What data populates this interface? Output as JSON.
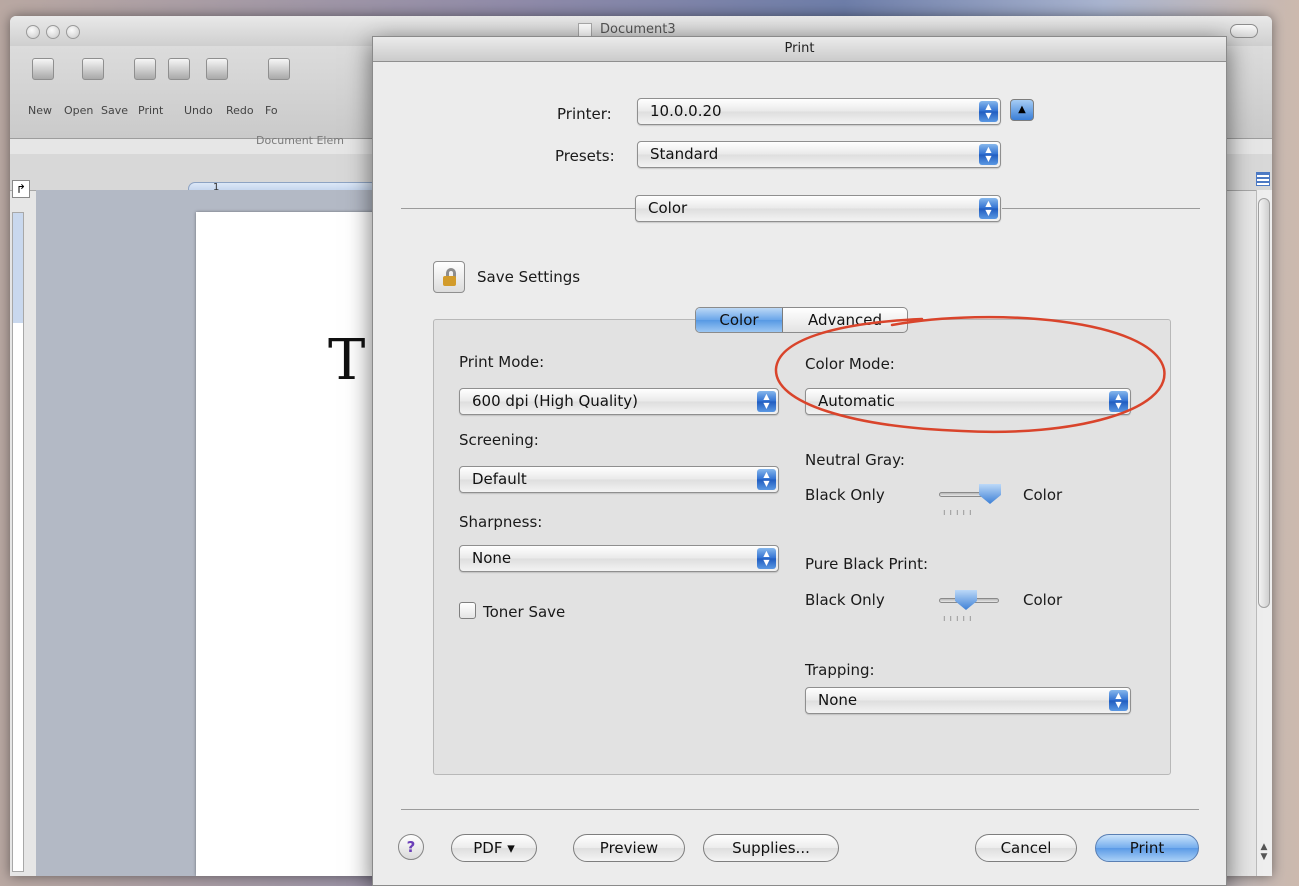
{
  "word": {
    "title": "Document3",
    "toolbar_labels": [
      "New",
      "Open",
      "Save",
      "Print",
      "Undo",
      "Redo",
      "Fo"
    ],
    "ribbon_group": "Document Elem",
    "document_letter": "T",
    "ruler_mark": "1"
  },
  "print": {
    "title": "Print",
    "printer_label": "Printer:",
    "printer_value": "10.0.0.20",
    "presets_label": "Presets:",
    "presets_value": "Standard",
    "pane_value": "Color",
    "save_settings": "Save Settings",
    "tabs": [
      {
        "label": "Color",
        "selected": true
      },
      {
        "label": "Advanced",
        "selected": false
      }
    ],
    "print_mode_label": "Print Mode:",
    "print_mode_value": "600 dpi (High Quality)",
    "screening_label": "Screening:",
    "screening_value": "Default",
    "sharpness_label": "Sharpness:",
    "sharpness_value": "None",
    "toner_save_label": "Toner Save",
    "toner_save_checked": false,
    "color_mode_label": "Color Mode:",
    "color_mode_value": "Automatic",
    "neutral_gray_label": "Neutral Gray:",
    "neutral_gray_left": "Black Only",
    "neutral_gray_right": "Color",
    "neutral_gray_level": 0.85,
    "pure_black_label": "Pure Black Print:",
    "pure_black_left": "Black Only",
    "pure_black_right": "Color",
    "pure_black_level": 0.45,
    "trapping_label": "Trapping:",
    "trapping_value": "None",
    "buttons": {
      "help": "?",
      "pdf": "PDF ▾",
      "preview": "Preview",
      "supplies": "Supplies...",
      "cancel": "Cancel",
      "print": "Print"
    },
    "annotation_color": "#d9442b"
  }
}
